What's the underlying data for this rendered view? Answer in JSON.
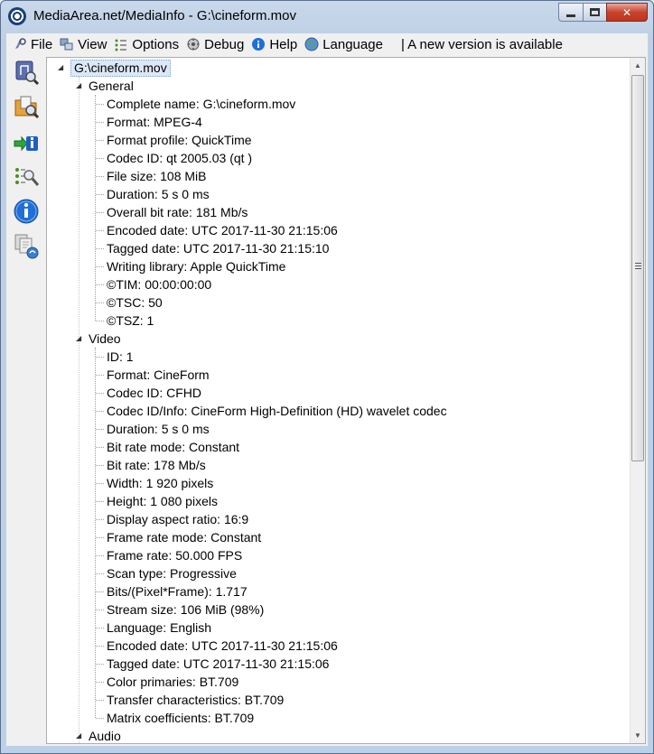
{
  "window": {
    "title": "MediaArea.net/MediaInfo - G:\\cineform.mov",
    "buttons": {
      "minimize": "minimize",
      "maximize": "maximize",
      "close": "✕"
    }
  },
  "menubar": {
    "items": [
      {
        "label": "File",
        "icon": "file-icon"
      },
      {
        "label": "View",
        "icon": "view-icon"
      },
      {
        "label": "Options",
        "icon": "options-icon"
      },
      {
        "label": "Debug",
        "icon": "debug-icon"
      },
      {
        "label": "Help",
        "icon": "help-icon"
      },
      {
        "label": "Language",
        "icon": "language-icon"
      }
    ],
    "notice": "| A new version is available"
  },
  "toolbar": {
    "items": [
      {
        "icon": "open-file-icon"
      },
      {
        "icon": "open-folder-icon"
      },
      {
        "icon": "export-info-icon"
      },
      {
        "icon": "preferences-icon"
      },
      {
        "icon": "about-icon"
      },
      {
        "icon": "new-version-icon"
      }
    ]
  },
  "tree": {
    "root": "G:\\cineform.mov",
    "sections": [
      {
        "name": "General",
        "fields": [
          "Complete name: G:\\cineform.mov",
          "Format: MPEG-4",
          "Format profile: QuickTime",
          "Codec ID: qt   2005.03 (qt  )",
          "File size: 108 MiB",
          "Duration: 5 s 0 ms",
          "Overall bit rate: 181 Mb/s",
          "Encoded date: UTC 2017-11-30 21:15:06",
          "Tagged date: UTC 2017-11-30 21:15:10",
          "Writing library: Apple QuickTime",
          "©TIM: 00:00:00:00",
          "©TSC: 50",
          "©TSZ: 1"
        ]
      },
      {
        "name": "Video",
        "fields": [
          "ID: 1",
          "Format: CineForm",
          "Codec ID: CFHD",
          "Codec ID/Info: CineForm High-Definition (HD) wavelet codec",
          "Duration: 5 s 0 ms",
          "Bit rate mode: Constant",
          "Bit rate: 178 Mb/s",
          "Width: 1 920 pixels",
          "Height: 1 080 pixels",
          "Display aspect ratio: 16:9",
          "Frame rate mode: Constant",
          "Frame rate: 50.000 FPS",
          "Scan type: Progressive",
          "Bits/(Pixel*Frame): 1.717",
          "Stream size: 106 MiB (98%)",
          "Language: English",
          "Encoded date: UTC 2017-11-30 21:15:06",
          "Tagged date: UTC 2017-11-30 21:15:06",
          "Color primaries: BT.709",
          "Transfer characteristics: BT.709",
          "Matrix coefficients: BT.709"
        ]
      },
      {
        "name": "Audio",
        "fields": []
      }
    ]
  }
}
